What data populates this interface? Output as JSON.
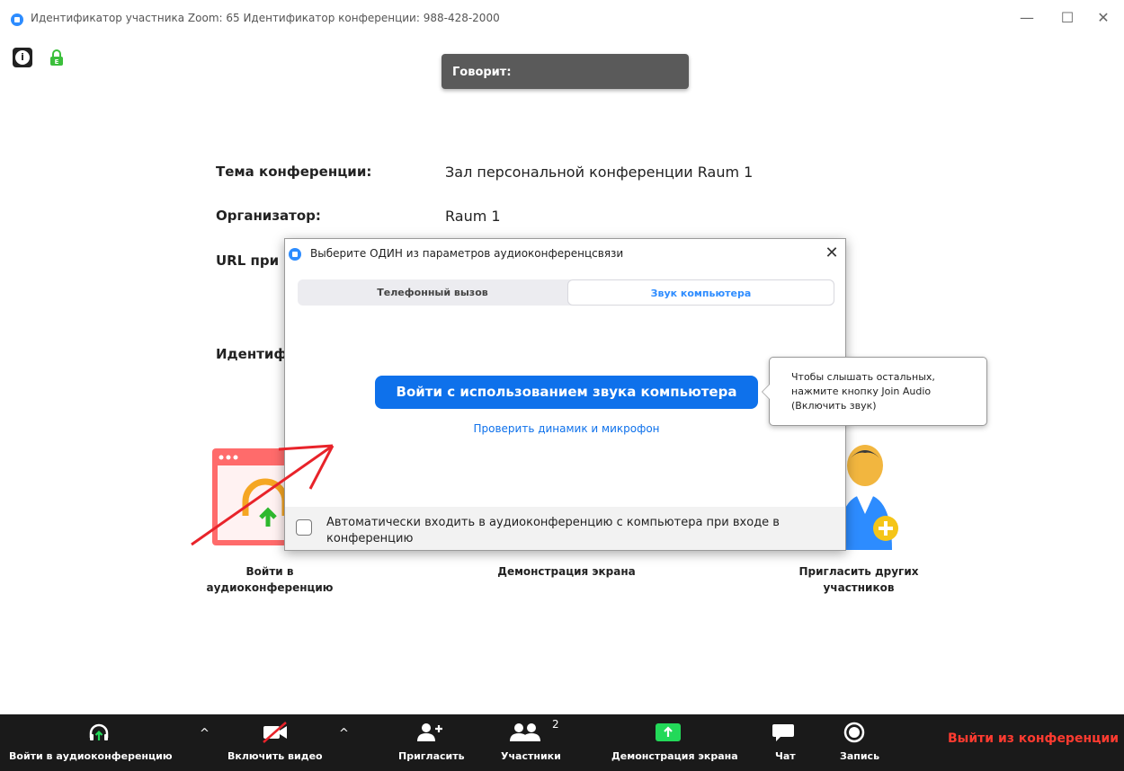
{
  "window": {
    "title": "Идентификатор участника Zoom: 65   Идентификатор конференции: 988-428-2000",
    "minimize": "—",
    "maximize": "☐",
    "close": "✕"
  },
  "speaker": {
    "label": "Говорит:"
  },
  "meeting_info": {
    "topic_label": "Тема конференции:",
    "topic_value": "Зал персональной конференции Raum 1",
    "host_label": "Организатор:",
    "host_value": "Raum 1",
    "url_label": "URL при",
    "id_label": "Идентиф"
  },
  "tiles": {
    "join_audio": "Войти в аудиоконференцию",
    "share_screen": "Демонстрация экрана",
    "invite": "Пригласить других участников"
  },
  "dialog": {
    "title": "Выберите ОДИН из параметров аудиоконференцсвязи",
    "close": "✕",
    "tab_phone": "Телефонный вызов",
    "tab_computer": "Звук компьютера",
    "join_button": "Войти с использованием звука компьютера",
    "test_link": "Проверить динамик и микрофон",
    "auto_join": "Автоматически входить в аудиоконференцию с компьютера при входе в конференцию"
  },
  "tooltip": {
    "line1": "Чтобы слышать остальных,",
    "line2": "нажмите кнопку Join Audio",
    "line3": "(Включить звук)"
  },
  "toolbar": {
    "join_audio": "Войти в аудиоконференцию",
    "start_video": "Включить видео",
    "invite": "Пригласить",
    "participants": "Участники",
    "participants_count": "2",
    "share_screen": "Демонстрация экрана",
    "chat": "Чат",
    "record": "Запись",
    "leave": "Выйти из конференции",
    "caret": "^"
  },
  "colors": {
    "accent": "#0e71eb",
    "leave": "#ff3b30",
    "toolbar_bg": "#1a1a1a",
    "share_green": "#23d959"
  }
}
